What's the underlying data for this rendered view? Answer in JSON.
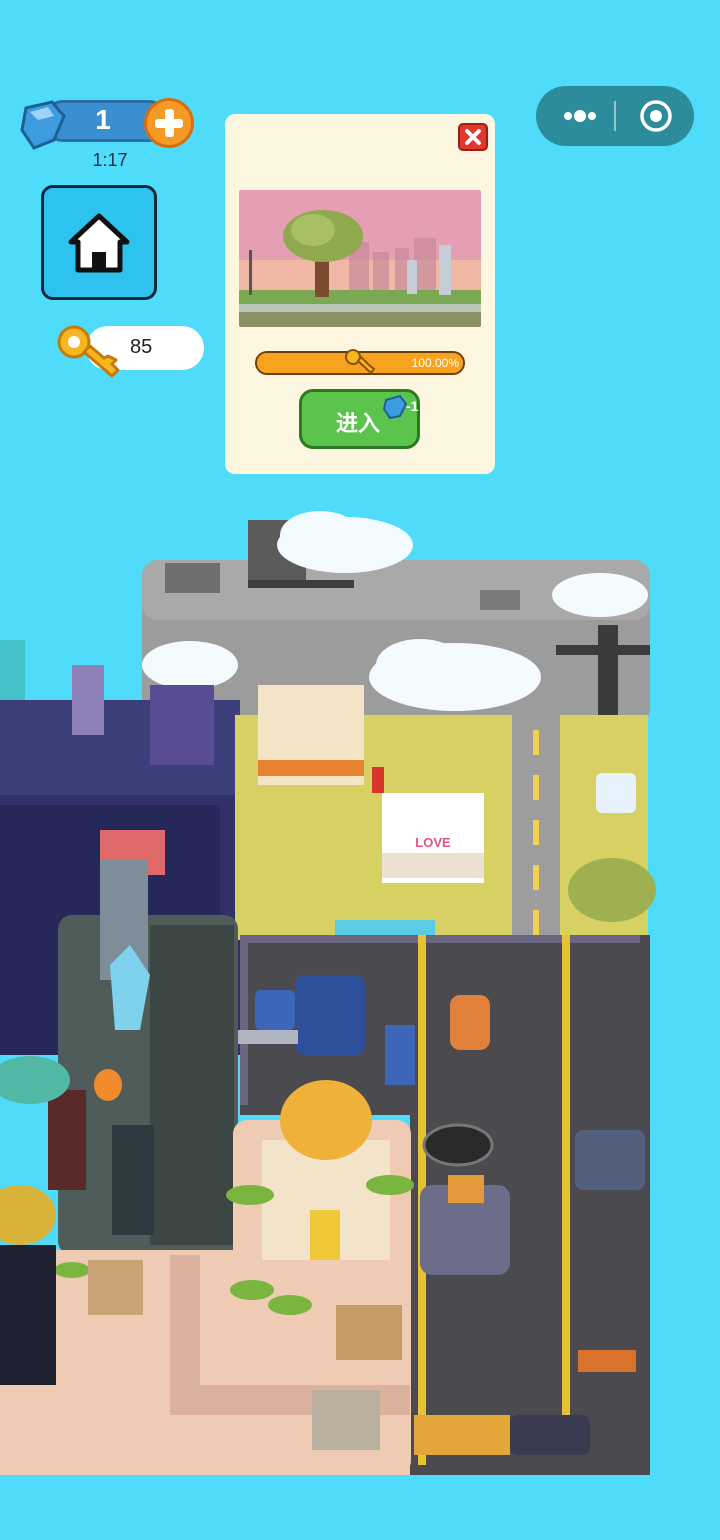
{
  "hud": {
    "energy_value": "1",
    "energy_timer": "1:17",
    "keys_count": "85"
  },
  "popup": {
    "progress_text": "100.00%",
    "progress_value": 1.0,
    "enter_label": "进入",
    "enter_cost": "-1"
  },
  "map": {
    "shop_sign": "LOVE"
  },
  "colors": {
    "background": "#4fdcfb",
    "popup_bg": "#fdf7e2",
    "enter_button": "#5bc44c",
    "progress": "#f59b25",
    "close_button": "#e2372a"
  }
}
